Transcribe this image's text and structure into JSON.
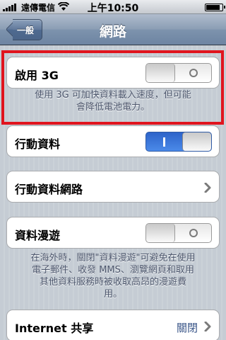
{
  "status_bar": {
    "carrier": "遠傳電信",
    "time": "上午10:50"
  },
  "nav": {
    "back_label": "一般",
    "title": "網路"
  },
  "enable_3g": {
    "label": "啟用 3G",
    "state": "off",
    "footer_line1": "使用 3G 可加快資料載入速度，但可能",
    "footer_line2": "會降低電池電力。"
  },
  "cellular_data": {
    "label": "行動資料",
    "state": "on",
    "on_glyph": "I"
  },
  "cellular_network": {
    "label": "行動資料網路"
  },
  "data_roaming": {
    "label": "資料漫遊",
    "state": "off",
    "footer_line1": "在海外時，關閉\"資料漫遊\"可避免在使用",
    "footer_line2": "電子郵件、收發 MMS、瀏覽網頁和取用",
    "footer_line3": "其他資料服務時被收取高昂的漫遊費",
    "footer_line4": "用。"
  },
  "internet_sharing": {
    "label": "Internet 共享",
    "value": "關閉"
  },
  "colors": {
    "highlight": "#e0141e",
    "switch_on": "#2d63c9",
    "value_text": "#385487",
    "background": "#c5ccd4"
  }
}
